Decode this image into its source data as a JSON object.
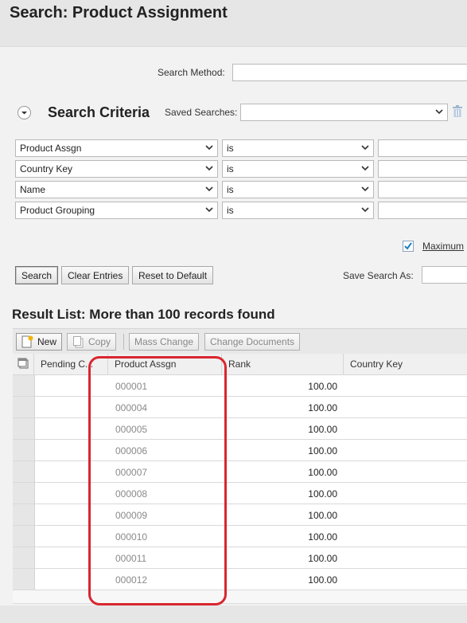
{
  "page": {
    "title": "Search: Product Assignment"
  },
  "search_method": {
    "label": "Search Method:",
    "value": ""
  },
  "criteria": {
    "title": "Search Criteria",
    "saved_searches_label": "Saved Searches:",
    "saved_searches_value": "",
    "rows": [
      {
        "field": "Product Assgn",
        "operator": "is",
        "value": ""
      },
      {
        "field": "Country Key",
        "operator": "is",
        "value": ""
      },
      {
        "field": "Name",
        "operator": "is",
        "value": ""
      },
      {
        "field": "Product Grouping",
        "operator": "is",
        "value": ""
      }
    ],
    "maximum_label": "Maximum",
    "maximum_checked": true
  },
  "actions": {
    "search": "Search",
    "clear": "Clear Entries",
    "reset": "Reset to Default",
    "save_as_label": "Save Search As:",
    "save_as_value": ""
  },
  "results": {
    "title": "Result List: More than 100 records found",
    "toolbar": {
      "new": "New",
      "copy": "Copy",
      "mass_change": "Mass Change",
      "change_documents": "Change Documents"
    },
    "columns": [
      "Pending C...",
      "Product Assgn",
      "Rank",
      "Country Key"
    ],
    "rows": [
      {
        "pending": "",
        "product": "000001",
        "rank": "100.00",
        "country": ""
      },
      {
        "pending": "",
        "product": "000004",
        "rank": "100.00",
        "country": ""
      },
      {
        "pending": "",
        "product": "000005",
        "rank": "100.00",
        "country": ""
      },
      {
        "pending": "",
        "product": "000006",
        "rank": "100.00",
        "country": ""
      },
      {
        "pending": "",
        "product": "000007",
        "rank": "100.00",
        "country": ""
      },
      {
        "pending": "",
        "product": "000008",
        "rank": "100.00",
        "country": ""
      },
      {
        "pending": "",
        "product": "000009",
        "rank": "100.00",
        "country": ""
      },
      {
        "pending": "",
        "product": "000010",
        "rank": "100.00",
        "country": ""
      },
      {
        "pending": "",
        "product": "000011",
        "rank": "100.00",
        "country": ""
      },
      {
        "pending": "",
        "product": "000012",
        "rank": "100.00",
        "country": ""
      }
    ]
  },
  "colors": {
    "highlight": "#d9262f",
    "checkbox": "#1a7fc1",
    "link_gray": "#8a8a8a"
  }
}
